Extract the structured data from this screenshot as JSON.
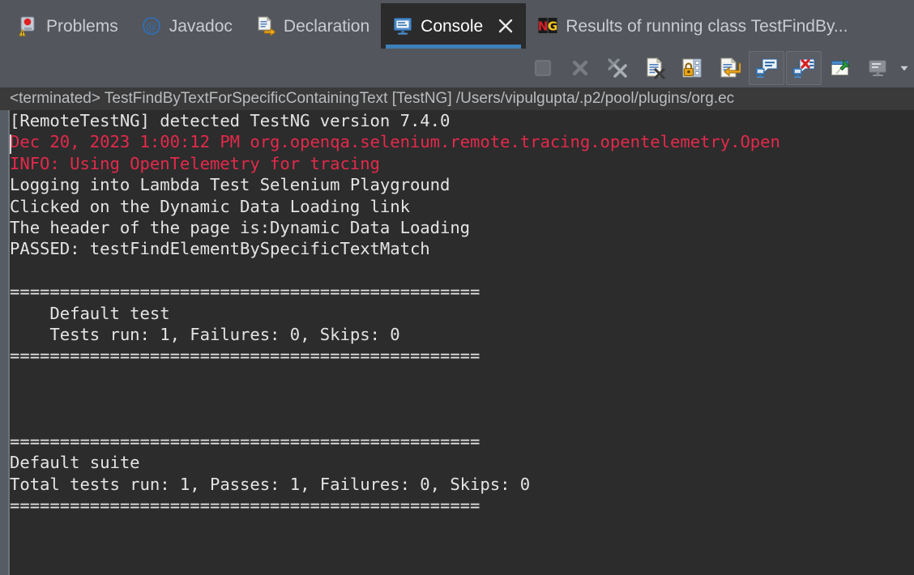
{
  "tabs": [
    {
      "label": "Problems",
      "icon": "problems-icon",
      "active": false,
      "closable": false
    },
    {
      "label": "Javadoc",
      "icon": "javadoc-icon",
      "active": false,
      "closable": false
    },
    {
      "label": "Declaration",
      "icon": "declaration-icon",
      "active": false,
      "closable": false
    },
    {
      "label": "Console",
      "icon": "console-icon",
      "active": true,
      "closable": true
    },
    {
      "label": "Results of running class TestFindBy...",
      "icon": "testng-icon",
      "active": false,
      "closable": false
    }
  ],
  "toolbar": {
    "buttons": [
      {
        "name": "terminate-button",
        "icon": "stop-square-icon",
        "enabled": false,
        "framed": false
      },
      {
        "name": "remove-launch-button",
        "icon": "x-icon",
        "enabled": false,
        "framed": false
      },
      {
        "name": "remove-all-terminated-button",
        "icon": "double-x-icon",
        "enabled": false,
        "framed": false
      },
      {
        "name": "clear-console-button",
        "icon": "clear-console-icon",
        "enabled": true,
        "framed": false
      },
      {
        "name": "scroll-lock-button",
        "icon": "scroll-lock-icon",
        "enabled": true,
        "framed": false
      },
      {
        "name": "word-wrap-button",
        "icon": "word-wrap-icon",
        "enabled": true,
        "framed": false
      },
      {
        "name": "show-console-on-output-button",
        "icon": "show-console-output-icon",
        "enabled": true,
        "framed": true
      },
      {
        "name": "show-console-on-error-button",
        "icon": "show-console-error-icon",
        "enabled": true,
        "framed": true
      },
      {
        "name": "pin-console-button",
        "icon": "pin-icon",
        "enabled": true,
        "framed": false
      },
      {
        "name": "display-selected-console-button",
        "icon": "display-console-icon",
        "enabled": true,
        "framed": false
      }
    ],
    "menu_arrow_icon": "chevron-down-icon"
  },
  "status": {
    "text": "<terminated> TestFindByTextForSpecificContainingText [TestNG] /Users/vipulgupta/.p2/pool/plugins/org.ec"
  },
  "console": {
    "colors": {
      "background": "#2c2c2c",
      "text": "#e4e4e4",
      "error": "#e4294b",
      "accent": "#3f7fb8"
    },
    "lines": [
      {
        "text": "[RemoteTestNG] detected TestNG version 7.4.0",
        "stream": "out"
      },
      {
        "text": "Dec 20, 2023 1:00:12 PM org.openqa.selenium.remote.tracing.opentelemetry.Open",
        "stream": "err"
      },
      {
        "text": "INFO: Using OpenTelemetry for tracing",
        "stream": "err"
      },
      {
        "text": "Logging into Lambda Test Selenium Playground",
        "stream": "out"
      },
      {
        "text": "Clicked on the Dynamic Data Loading link",
        "stream": "out"
      },
      {
        "text": "The header of the page is:Dynamic Data Loading",
        "stream": "out"
      },
      {
        "text": "PASSED: testFindElementBySpecificTextMatch",
        "stream": "out"
      },
      {
        "text": "",
        "stream": "out"
      },
      {
        "text": "===============================================",
        "stream": "out"
      },
      {
        "text": "    Default test",
        "stream": "out"
      },
      {
        "text": "    Tests run: 1, Failures: 0, Skips: 0",
        "stream": "out"
      },
      {
        "text": "===============================================",
        "stream": "out"
      },
      {
        "text": "",
        "stream": "out"
      },
      {
        "text": "",
        "stream": "out"
      },
      {
        "text": "",
        "stream": "out"
      },
      {
        "text": "===============================================",
        "stream": "out"
      },
      {
        "text": "Default suite",
        "stream": "out"
      },
      {
        "text": "Total tests run: 1, Passes: 1, Failures: 0, Skips: 0",
        "stream": "out"
      },
      {
        "text": "===============================================",
        "stream": "out"
      }
    ]
  }
}
